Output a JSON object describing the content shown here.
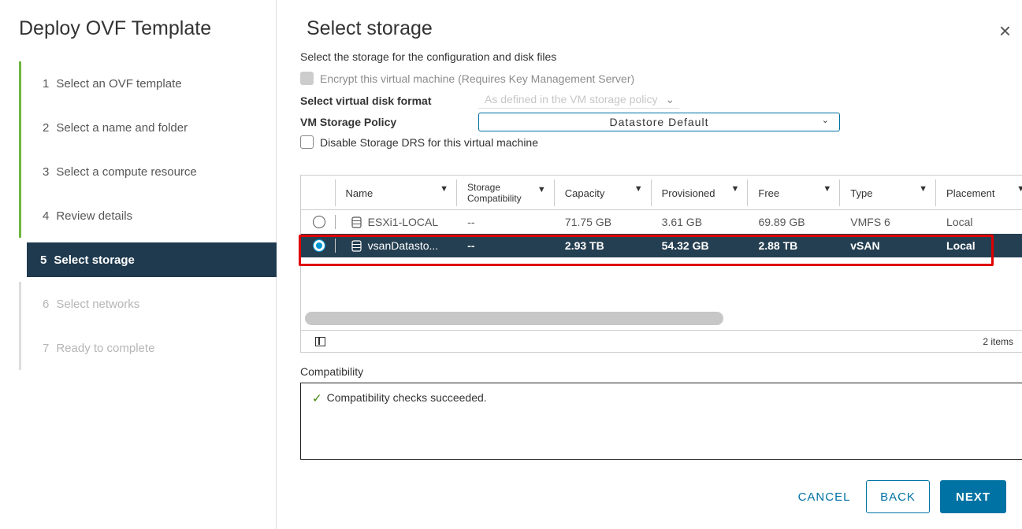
{
  "wizard": {
    "title": "Deploy OVF Template",
    "steps": [
      {
        "num": "1",
        "label": "Select an OVF template"
      },
      {
        "num": "2",
        "label": "Select a name and folder"
      },
      {
        "num": "3",
        "label": "Select a compute resource"
      },
      {
        "num": "4",
        "label": "Review details"
      },
      {
        "num": "5",
        "label": "Select storage"
      },
      {
        "num": "6",
        "label": "Select networks"
      },
      {
        "num": "7",
        "label": "Ready to complete"
      }
    ],
    "current_step": 5
  },
  "page": {
    "title": "Select storage",
    "subtitle": "Select the storage for the configuration and disk files",
    "close_icon": "×"
  },
  "options": {
    "encrypt_label": "Encrypt this virtual machine (Requires Key Management Server)",
    "encrypt_checked": false,
    "encrypt_disabled": true,
    "disk_format_label": "Select virtual disk format",
    "disk_format_value": "As defined in the VM storage policy",
    "storage_policy_label": "VM Storage Policy",
    "storage_policy_value": "Datastore Default",
    "disable_drs_label": "Disable Storage DRS for this virtual machine",
    "disable_drs_checked": false,
    "caret": "⌄"
  },
  "grid": {
    "columns": [
      "Name",
      "Storage Compatibility",
      "Capacity",
      "Provisioned",
      "Free",
      "Type",
      "Placement"
    ],
    "column_line1": "Storage",
    "column_line2": "Compatibility",
    "filter_icon": "▼",
    "rows": [
      {
        "name": "ESXi1-LOCAL",
        "compat": "--",
        "capacity": "71.75 GB",
        "provisioned": "3.61 GB",
        "free": "69.89 GB",
        "type": "VMFS 6",
        "placement": "Local",
        "selected": false
      },
      {
        "name": "vsanDatasto...",
        "compat": "--",
        "capacity": "2.93 TB",
        "provisioned": "54.32 GB",
        "free": "2.88 TB",
        "type": "vSAN",
        "placement": "Local",
        "selected": true
      }
    ],
    "item_count": "2 items"
  },
  "compatibility": {
    "label": "Compatibility",
    "message": "Compatibility checks succeeded.",
    "check_icon": "✓"
  },
  "buttons": {
    "cancel": "CANCEL",
    "back": "BACK",
    "next": "NEXT"
  },
  "colors": {
    "accent": "#0072a3",
    "selected_row": "#253f52",
    "current_step": "#1f3a4f",
    "done_step": "#6fb83f",
    "highlight": "#e00000"
  }
}
